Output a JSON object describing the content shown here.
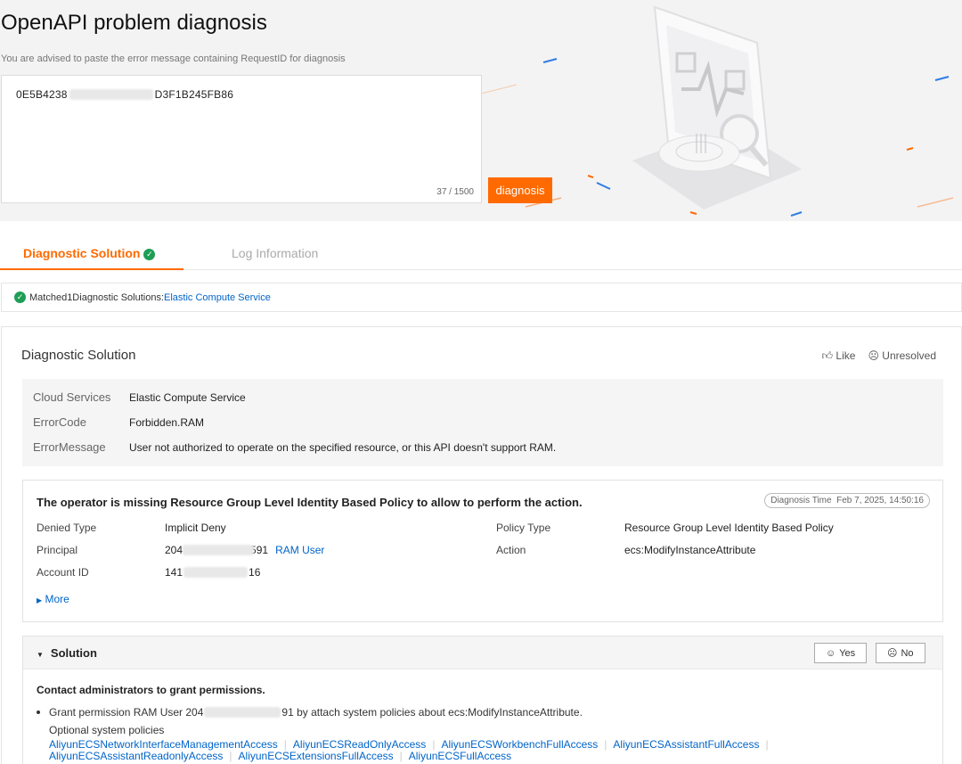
{
  "header": {
    "title": "OpenAPI problem diagnosis",
    "subtitle": "You are advised to paste the error message containing RequestID for diagnosis",
    "request_prefix": "0E5B4238",
    "request_suffix": "D3F1B245FB86",
    "char_count": "37 / 1500",
    "diagnose_label": "diagnosis"
  },
  "tabs": {
    "solution": "Diagnostic Solution",
    "log": "Log Information"
  },
  "matched": {
    "label": "Matched1Diagnostic Solutions:",
    "service_link": "Elastic Compute Service"
  },
  "diagnostic": {
    "title": "Diagnostic Solution",
    "like_label": "Like",
    "unresolved_label": "Unresolved",
    "info": [
      {
        "key": "Cloud Services",
        "value": "Elastic Compute Service"
      },
      {
        "key": "ErrorCode",
        "value": "Forbidden.RAM"
      },
      {
        "key": "ErrorMessage",
        "value": "User not authorized to operate on the specified resource, or this API doesn't support RAM."
      }
    ]
  },
  "operator": {
    "title": "The operator is missing Resource Group Level Identity Based Policy to allow to perform the action.",
    "diag_time_label": "Diagnosis Time",
    "diag_time": "Feb 7, 2025, 14:50:16",
    "denied_type_label": "Denied Type",
    "denied_type": "Implicit Deny",
    "principal_label": "Principal",
    "principal_prefix": "204",
    "principal_suffix": "591",
    "principal_link": "RAM User",
    "account_label": "Account ID",
    "account_prefix": "141",
    "account_suffix": "16",
    "policy_type_label": "Policy Type",
    "policy_type": "Resource Group Level Identity Based Policy",
    "action_label": "Action",
    "action": "ecs:ModifyInstanceAttribute",
    "more_label": "More"
  },
  "solution": {
    "title": "Solution",
    "yes_label": "Yes",
    "no_label": "No",
    "heading": "Contact administrators to grant permissions.",
    "item_prefix": "Grant permission RAM User 204",
    "item_suffix": "91 by attach system policies about ecs:ModifyInstanceAttribute.",
    "optional_label": "Optional system policies",
    "policies_row1": [
      "AliyunECSNetworkInterfaceManagementAccess",
      "AliyunECSReadOnlyAccess",
      "AliyunECSWorkbenchFullAccess",
      "AliyunECSAssistantFullAccess"
    ],
    "policies_row2": [
      "AliyunECSAssistantReadonlyAccess",
      "AliyunECSExtensionsFullAccess",
      "AliyunECSFullAccess"
    ]
  },
  "colors": {
    "accent": "#ff6a00",
    "link": "#0064c8",
    "success": "#1e9e55"
  }
}
